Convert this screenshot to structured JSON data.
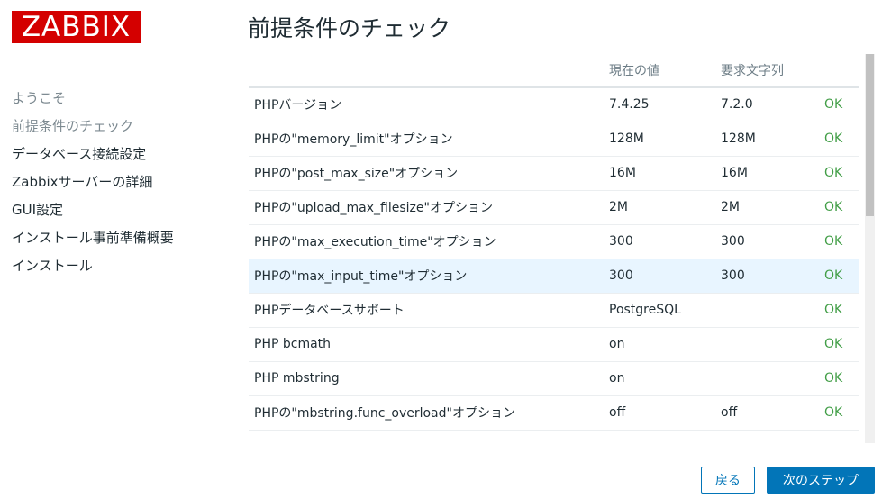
{
  "logo": {
    "text": "ZABBIX",
    "color": "#d40000"
  },
  "page_title": "前提条件のチェック",
  "steps": [
    {
      "label": "ようこそ",
      "state": "done"
    },
    {
      "label": "前提条件のチェック",
      "state": "current"
    },
    {
      "label": "データベース接続設定",
      "state": "pending"
    },
    {
      "label": "Zabbixサーバーの詳細",
      "state": "pending"
    },
    {
      "label": "GUI設定",
      "state": "pending"
    },
    {
      "label": "インストール事前準備概要",
      "state": "pending"
    },
    {
      "label": "インストール",
      "state": "pending"
    }
  ],
  "table": {
    "headers": [
      "",
      "現在の値",
      "要求文字列",
      ""
    ],
    "rows": [
      {
        "name": "PHPバージョン",
        "current": "7.4.25",
        "required": "7.2.0",
        "status": "OK"
      },
      {
        "name": "PHPの\"memory_limit\"オプション",
        "current": "128M",
        "required": "128M",
        "status": "OK"
      },
      {
        "name": "PHPの\"post_max_size\"オプション",
        "current": "16M",
        "required": "16M",
        "status": "OK"
      },
      {
        "name": "PHPの\"upload_max_filesize\"オプション",
        "current": "2M",
        "required": "2M",
        "status": "OK"
      },
      {
        "name": "PHPの\"max_execution_time\"オプション",
        "current": "300",
        "required": "300",
        "status": "OK"
      },
      {
        "name": "PHPの\"max_input_time\"オプション",
        "current": "300",
        "required": "300",
        "status": "OK",
        "highlighted": true
      },
      {
        "name": "PHPデータベースサポート",
        "current": "PostgreSQL",
        "required": "",
        "status": "OK"
      },
      {
        "name": "PHP bcmath",
        "current": "on",
        "required": "",
        "status": "OK"
      },
      {
        "name": "PHP mbstring",
        "current": "on",
        "required": "",
        "status": "OK"
      },
      {
        "name": "PHPの\"mbstring.func_overload\"オプション",
        "current": "off",
        "required": "off",
        "status": "OK"
      }
    ]
  },
  "buttons": {
    "back": "戻る",
    "next": "次のステップ"
  },
  "colors": {
    "ok": "#429e47",
    "accent": "#0275b8",
    "highlight_row": "#e8f5ff"
  }
}
